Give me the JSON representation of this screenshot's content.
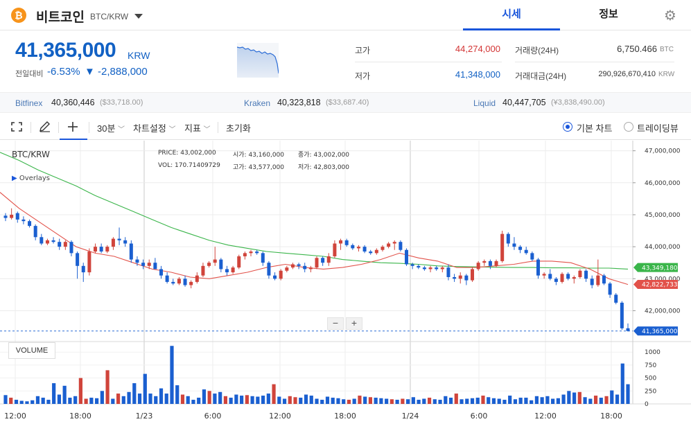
{
  "header": {
    "coin_symbol": "₿",
    "coin_name": "비트코인",
    "pair": "BTC/KRW",
    "tabs": [
      "시세",
      "정보"
    ],
    "active_tab": "시세",
    "settings_icon": "gear-icon"
  },
  "price": {
    "current": "41,365,000",
    "unit": "KRW",
    "change_label": "전일대비",
    "change_pct": "-6.53%",
    "change_amount": "▼ -2,888,000",
    "color_down": "#1261c4",
    "color_up": "#d33434"
  },
  "stats": {
    "high_label": "고가",
    "high_value": "44,274,000",
    "low_label": "저가",
    "low_value": "41,348,000",
    "volume_label": "거래량(24H)",
    "volume_value": "6,750.466",
    "volume_unit": "BTC",
    "amount_label": "거래대금(24H)",
    "amount_value": "290,926,670,410",
    "amount_unit": "KRW"
  },
  "exchanges": [
    {
      "name": "Bitfinex",
      "price": "40,360,446",
      "usd": "($33,718.00)"
    },
    {
      "name": "Kraken",
      "price": "40,323,818",
      "usd": "($33,687.40)"
    },
    {
      "name": "Liquid",
      "price": "40,447,705",
      "usd": "(¥3,838,490.00)"
    }
  ],
  "toolbar": {
    "interval": "30분",
    "chart_settings": "차트설정",
    "indicators": "지표",
    "reset": "초기화",
    "basic_chart": "기본 차트",
    "tradingview": "트레이딩뷰",
    "basic_selected": true
  },
  "chart_info": {
    "symbol": "BTC/KRW",
    "overlays": "Overlays",
    "price_label": "PRICE:",
    "price_val": "43,002,000",
    "open_label": "시가:",
    "open_val": "43,160,000",
    "close_label": "종가:",
    "close_val": "43,002,000",
    "vol_label": "VOL:",
    "vol_val": "170.71409729",
    "high_label": "고가:",
    "high_val": "43,577,000",
    "low_label": "저가:",
    "low_val": "42,803,000",
    "volume_title": "VOLUME",
    "zoom_out": "−",
    "zoom_in": "+"
  },
  "chart_data": {
    "type": "candlestick",
    "y_axis_ticks": [
      "47,000,000",
      "46,000,000",
      "45,000,000",
      "44,000,000",
      "43,000,000",
      "42,000,000"
    ],
    "ylim": [
      41100000,
      47100000
    ],
    "x_ticks": [
      "12:00",
      "18:00",
      "1/23",
      "6:00",
      "12:00",
      "18:00",
      "1/24",
      "6:00",
      "12:00",
      "18:00"
    ],
    "volume_ticks": [
      "1000",
      "750",
      "500",
      "250",
      "0"
    ],
    "volume_ylim": [
      0,
      1150
    ],
    "last_price_tag": "41,365,000",
    "ma_green_tag": "43,349,180",
    "ma_red_tag": "42,822,733",
    "colors": {
      "up": "#d0443b",
      "down": "#1a5fd0",
      "ma_long": "#3ab54a",
      "ma_short": "#e2524a"
    },
    "candles": [
      [
        44.97,
        45.05,
        44.8,
        44.9
      ],
      [
        44.9,
        45.2,
        44.85,
        45.0
      ],
      [
        45.05,
        45.1,
        44.75,
        44.85
      ],
      [
        44.85,
        44.95,
        44.7,
        44.8
      ],
      [
        44.8,
        44.85,
        44.6,
        44.65
      ],
      [
        44.65,
        44.7,
        44.2,
        44.3
      ],
      [
        44.3,
        44.4,
        44.05,
        44.1
      ],
      [
        44.1,
        44.25,
        44.05,
        44.2
      ],
      [
        44.2,
        44.3,
        44.1,
        44.15
      ],
      [
        44.15,
        44.25,
        43.9,
        44.0
      ],
      [
        44.0,
        44.2,
        43.9,
        44.15
      ],
      [
        44.15,
        44.2,
        43.7,
        43.8
      ],
      [
        43.8,
        43.85,
        43.0,
        43.4
      ],
      [
        43.4,
        43.5,
        42.9,
        43.2
      ],
      [
        43.2,
        43.95,
        43.1,
        43.85
      ],
      [
        43.85,
        44.1,
        43.8,
        44.0
      ],
      [
        44.0,
        44.1,
        43.8,
        43.85
      ],
      [
        43.85,
        44.05,
        43.8,
        44.0
      ],
      [
        44.0,
        44.3,
        43.9,
        44.25
      ],
      [
        44.25,
        44.6,
        44.05,
        44.2
      ],
      [
        44.2,
        44.3,
        44.0,
        44.1
      ],
      [
        44.1,
        44.2,
        43.5,
        43.6
      ],
      [
        43.6,
        43.7,
        43.4,
        43.5
      ],
      [
        43.5,
        43.6,
        43.3,
        43.4
      ],
      [
        43.4,
        43.6,
        43.3,
        43.5
      ],
      [
        43.5,
        43.65,
        43.4,
        43.3
      ],
      [
        43.3,
        43.4,
        43.0,
        43.1
      ],
      [
        43.1,
        43.2,
        42.85,
        42.9
      ],
      [
        42.9,
        43.0,
        42.8,
        42.85
      ],
      [
        42.85,
        43.05,
        42.8,
        43.0
      ],
      [
        43.0,
        43.1,
        42.75,
        42.8
      ],
      [
        42.8,
        42.95,
        42.7,
        42.9
      ],
      [
        42.9,
        43.2,
        42.85,
        43.1
      ],
      [
        43.1,
        43.5,
        43.05,
        43.4
      ],
      [
        43.4,
        43.55,
        43.35,
        43.5
      ],
      [
        43.5,
        44.0,
        43.4,
        43.6
      ],
      [
        43.6,
        43.65,
        43.2,
        43.3
      ],
      [
        43.3,
        43.4,
        43.1,
        43.2
      ],
      [
        43.2,
        43.4,
        43.15,
        43.35
      ],
      [
        43.35,
        43.75,
        43.3,
        43.7
      ],
      [
        43.7,
        43.85,
        43.6,
        43.8
      ],
      [
        43.8,
        43.9,
        43.7,
        43.85
      ],
      [
        43.85,
        43.9,
        43.75,
        43.8
      ],
      [
        43.8,
        43.85,
        43.4,
        43.5
      ],
      [
        43.5,
        43.55,
        43.0,
        43.1
      ],
      [
        43.1,
        43.2,
        42.95,
        43.0
      ],
      [
        43.0,
        43.3,
        42.95,
        43.25
      ],
      [
        43.25,
        43.4,
        43.2,
        43.35
      ],
      [
        43.35,
        43.5,
        43.3,
        43.45
      ],
      [
        43.45,
        43.5,
        43.3,
        43.4
      ],
      [
        43.4,
        43.5,
        43.2,
        43.3
      ],
      [
        43.3,
        43.4,
        43.2,
        43.35
      ],
      [
        43.35,
        43.7,
        43.3,
        43.65
      ],
      [
        43.65,
        43.7,
        43.4,
        43.5
      ],
      [
        43.5,
        43.8,
        43.4,
        43.7
      ],
      [
        43.7,
        44.2,
        43.65,
        44.1
      ],
      [
        44.1,
        44.25,
        43.9,
        44.2
      ],
      [
        44.2,
        44.25,
        44.0,
        44.05
      ],
      [
        44.05,
        44.1,
        43.9,
        43.95
      ],
      [
        43.95,
        44.05,
        43.85,
        44.0
      ],
      [
        44.0,
        44.05,
        43.8,
        43.85
      ],
      [
        43.85,
        43.9,
        43.75,
        43.8
      ],
      [
        43.8,
        43.95,
        43.75,
        43.9
      ],
      [
        43.9,
        44.05,
        43.85,
        44.0
      ],
      [
        44.0,
        44.15,
        43.95,
        44.1
      ],
      [
        44.1,
        44.2,
        43.9,
        44.15
      ],
      [
        44.15,
        44.2,
        43.85,
        43.9
      ],
      [
        43.9,
        43.95,
        43.4,
        43.45
      ],
      [
        43.45,
        43.5,
        43.3,
        43.4
      ],
      [
        43.4,
        43.45,
        43.3,
        43.35
      ],
      [
        43.35,
        43.4,
        43.25,
        43.3
      ],
      [
        43.3,
        43.4,
        43.2,
        43.35
      ],
      [
        43.35,
        43.4,
        43.25,
        43.3
      ],
      [
        43.3,
        43.4,
        43.2,
        43.35
      ],
      [
        43.35,
        43.45,
        42.95,
        43.05
      ],
      [
        43.05,
        43.15,
        42.9,
        43.0
      ],
      [
        43.0,
        43.2,
        42.85,
        43.1
      ],
      [
        43.1,
        43.15,
        42.8,
        42.95
      ],
      [
        42.95,
        43.35,
        42.9,
        43.3
      ],
      [
        43.3,
        43.55,
        43.25,
        43.5
      ],
      [
        43.5,
        43.6,
        43.4,
        43.55
      ],
      [
        43.55,
        43.6,
        43.3,
        43.4
      ],
      [
        43.4,
        43.6,
        43.35,
        43.55
      ],
      [
        43.55,
        44.5,
        43.5,
        44.4
      ],
      [
        44.4,
        44.45,
        44.0,
        44.1
      ],
      [
        44.1,
        44.3,
        43.9,
        44.0
      ],
      [
        44.0,
        44.05,
        43.8,
        43.9
      ],
      [
        43.9,
        44.0,
        43.75,
        43.8
      ],
      [
        43.8,
        43.85,
        43.55,
        43.6
      ],
      [
        43.6,
        43.65,
        43.0,
        43.1
      ],
      [
        43.1,
        43.2,
        43.0,
        43.15
      ],
      [
        43.15,
        43.3,
        42.95,
        43.0
      ],
      [
        43.0,
        43.05,
        42.8,
        42.9
      ],
      [
        42.9,
        43.2,
        42.85,
        43.15
      ],
      [
        43.15,
        43.2,
        42.95,
        43.0
      ],
      [
        43.0,
        43.1,
        42.85,
        43.05
      ],
      [
        43.05,
        43.3,
        43.0,
        43.25
      ],
      [
        43.25,
        43.3,
        42.9,
        43.0
      ],
      [
        43.0,
        43.1,
        42.7,
        42.8
      ],
      [
        42.8,
        43.6,
        42.75,
        43.1
      ],
      [
        43.1,
        43.15,
        42.8,
        42.85
      ],
      [
        42.85,
        42.9,
        42.4,
        42.5
      ],
      [
        42.5,
        42.55,
        42.2,
        42.25
      ],
      [
        42.25,
        42.3,
        41.4,
        41.45
      ],
      [
        41.45,
        41.6,
        41.35,
        41.365
      ]
    ],
    "volumes": [
      [
        170,
        1
      ],
      [
        120,
        0
      ],
      [
        80,
        1
      ],
      [
        60,
        1
      ],
      [
        50,
        1
      ],
      [
        70,
        1
      ],
      [
        150,
        1
      ],
      [
        120,
        1
      ],
      [
        80,
        1
      ],
      [
        400,
        1
      ],
      [
        180,
        1
      ],
      [
        350,
        1
      ],
      [
        120,
        1
      ],
      [
        150,
        1
      ],
      [
        500,
        0
      ],
      [
        100,
        0
      ],
      [
        120,
        1
      ],
      [
        110,
        1
      ],
      [
        250,
        1
      ],
      [
        650,
        0
      ],
      [
        100,
        1
      ],
      [
        200,
        0
      ],
      [
        150,
        1
      ],
      [
        230,
        1
      ],
      [
        400,
        1
      ],
      [
        200,
        1
      ],
      [
        580,
        1
      ],
      [
        200,
        1
      ],
      [
        150,
        1
      ],
      [
        300,
        1
      ],
      [
        200,
        1
      ],
      [
        1120,
        1
      ],
      [
        360,
        1
      ],
      [
        180,
        0
      ],
      [
        150,
        1
      ],
      [
        80,
        1
      ],
      [
        120,
        1
      ],
      [
        280,
        1
      ],
      [
        250,
        0
      ],
      [
        200,
        1
      ],
      [
        230,
        1
      ],
      [
        150,
        0
      ],
      [
        120,
        1
      ],
      [
        180,
        1
      ],
      [
        160,
        1
      ],
      [
        170,
        0
      ],
      [
        150,
        1
      ],
      [
        140,
        1
      ],
      [
        160,
        1
      ],
      [
        200,
        1
      ],
      [
        380,
        0
      ],
      [
        140,
        1
      ],
      [
        100,
        1
      ],
      [
        150,
        0
      ],
      [
        130,
        0
      ],
      [
        120,
        1
      ],
      [
        180,
        1
      ],
      [
        160,
        1
      ],
      [
        100,
        1
      ],
      [
        80,
        1
      ],
      [
        140,
        1
      ],
      [
        120,
        1
      ],
      [
        110,
        1
      ],
      [
        90,
        1
      ],
      [
        80,
        0
      ],
      [
        100,
        1
      ],
      [
        160,
        0
      ],
      [
        140,
        1
      ],
      [
        130,
        0
      ],
      [
        120,
        1
      ],
      [
        110,
        1
      ],
      [
        100,
        1
      ],
      [
        90,
        0
      ],
      [
        80,
        1
      ],
      [
        100,
        0
      ],
      [
        90,
        1
      ],
      [
        130,
        1
      ],
      [
        80,
        1
      ],
      [
        100,
        1
      ],
      [
        120,
        0
      ],
      [
        90,
        1
      ],
      [
        80,
        1
      ],
      [
        150,
        1
      ],
      [
        120,
        1
      ],
      [
        200,
        0
      ],
      [
        90,
        1
      ],
      [
        100,
        1
      ],
      [
        110,
        1
      ],
      [
        120,
        1
      ],
      [
        160,
        0
      ],
      [
        130,
        1
      ],
      [
        110,
        1
      ],
      [
        100,
        1
      ],
      [
        80,
        1
      ],
      [
        160,
        1
      ],
      [
        90,
        1
      ],
      [
        120,
        1
      ],
      [
        120,
        1
      ],
      [
        70,
        1
      ],
      [
        150,
        1
      ],
      [
        130,
        1
      ],
      [
        150,
        1
      ],
      [
        100,
        1
      ],
      [
        110,
        1
      ],
      [
        180,
        1
      ],
      [
        250,
        1
      ],
      [
        220,
        1
      ],
      [
        230,
        0
      ],
      [
        130,
        1
      ],
      [
        100,
        1
      ],
      [
        160,
        0
      ],
      [
        120,
        1
      ],
      [
        150,
        0
      ],
      [
        260,
        1
      ],
      [
        180,
        1
      ],
      [
        780,
        1
      ],
      [
        380,
        1
      ]
    ],
    "ma_long": [
      46.95,
      46.7,
      46.4,
      46.15,
      45.9,
      45.6,
      45.35,
      45.1,
      44.85,
      44.6,
      44.4,
      44.2,
      44.05,
      43.95,
      43.85,
      43.8,
      43.75,
      43.7,
      43.6,
      43.55,
      43.5,
      43.48,
      43.45,
      43.4,
      43.38,
      43.37,
      43.36,
      43.35,
      43.35,
      43.34,
      43.34,
      43.33,
      43.33,
      43.3
    ],
    "ma_short": [
      45.7,
      45.2,
      44.8,
      44.4,
      44.0,
      43.8,
      43.7,
      43.5,
      43.3,
      43.2,
      43.05,
      43.0,
      43.1,
      43.2,
      43.35,
      43.45,
      43.35,
      43.3,
      43.35,
      43.45,
      43.6,
      43.8,
      43.65,
      43.55,
      43.35,
      43.35,
      43.4,
      43.45,
      43.55,
      43.55,
      43.5,
      43.3,
      43.0,
      42.82
    ]
  }
}
